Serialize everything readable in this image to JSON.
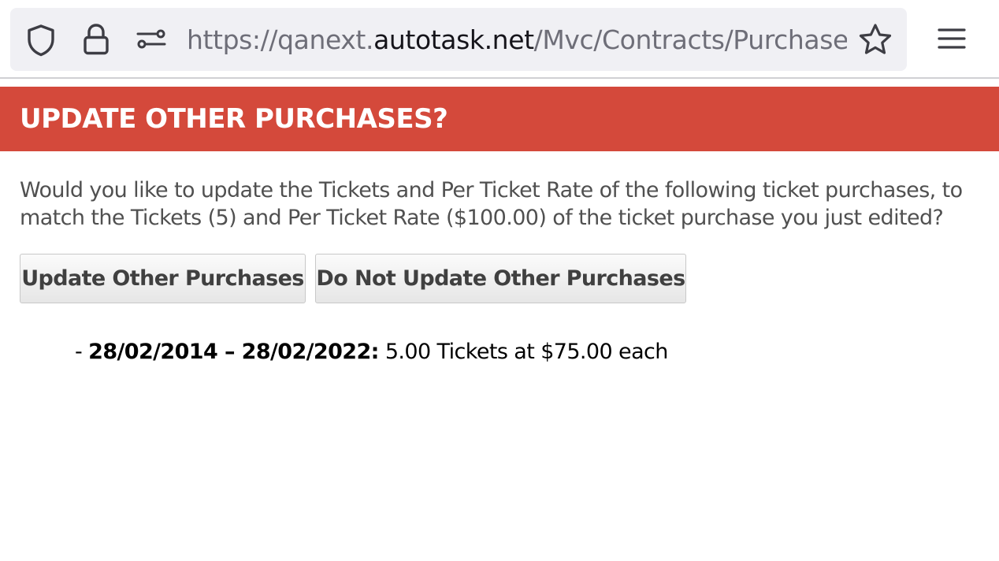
{
  "browser": {
    "url_prefix": "https://qanext.",
    "url_host": "autotask.net",
    "url_path": "/Mvc/Contracts/Purchase.mvc",
    "icons": [
      "shield-icon",
      "lock-icon",
      "site-settings-icon",
      "bookmark-star-icon",
      "hamburger-menu-icon"
    ]
  },
  "dialog": {
    "title": "UPDATE OTHER PURCHASES?",
    "question": "Would you like to update the Tickets and Per Ticket Rate of the following ticket purchases, to match the Tickets (5) and Per Ticket Rate ($100.00) of the ticket purchase you just edited?",
    "update_button": "Update Other Purchases",
    "skip_button": "Do Not Update Other Purchases",
    "header_color": "#d4493b"
  },
  "purchases": [
    {
      "prefix": "- ",
      "range": "28/02/2014 – 28/02/2022:",
      "detail": " 5.00 Tickets at $75.00 each"
    }
  ]
}
